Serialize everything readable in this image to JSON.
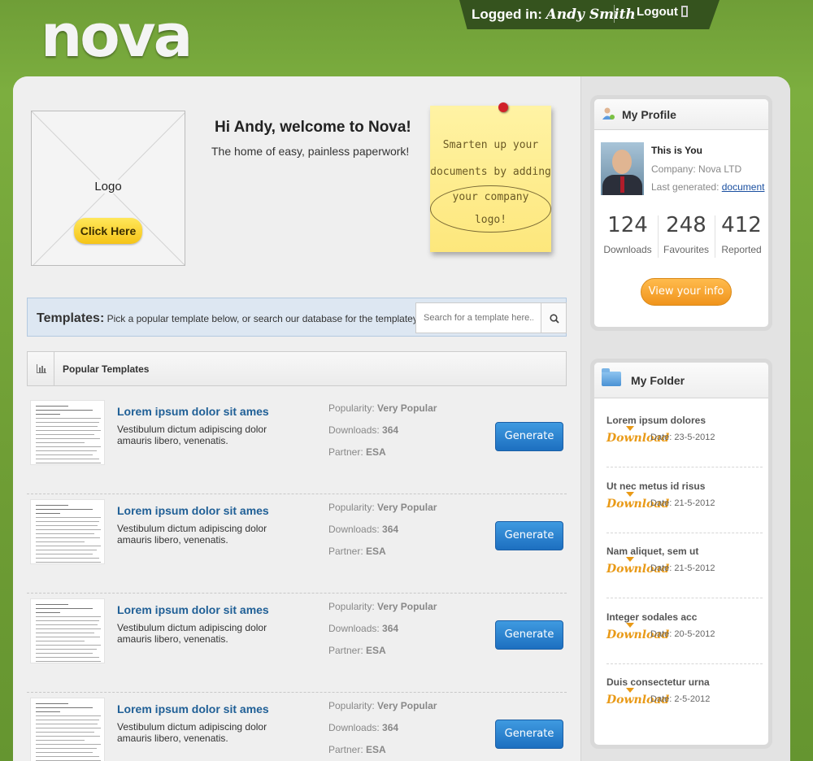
{
  "header": {
    "brand": "nova",
    "logged_in_label": "Logged in:",
    "user_name": "Andy Smith",
    "logout_label": "Logout"
  },
  "welcome": {
    "logo_placeholder": "Logo",
    "click_here": "Click Here",
    "title": "Hi Andy, welcome to Nova!",
    "subtitle": "The home of easy, painless paperwork!",
    "sticky_note": {
      "line1": "Smarten up your",
      "line2": "documents by adding",
      "line3": "your company logo!"
    }
  },
  "templates_bar": {
    "label": "Templates:",
    "text": "Pick a popular template below, or search our database for the templateyou need!",
    "search_placeholder": "Search for a template here..."
  },
  "popular": {
    "title": "Popular Templates",
    "items": [
      {
        "title": "Lorem ipsum dolor sit ames",
        "desc": "Vestibulum dictum adipiscing dolor amauris libero, venenatis.",
        "popularity_label": "Popularity:",
        "popularity": "Very Popular",
        "downloads_label": "Downloads:",
        "downloads": "364",
        "partner_label": "Partner:",
        "partner": "ESA",
        "button": "Generate"
      },
      {
        "title": "Lorem ipsum dolor sit ames",
        "desc": "Vestibulum dictum adipiscing dolor amauris libero, venenatis.",
        "popularity_label": "Popularity:",
        "popularity": "Very Popular",
        "downloads_label": "Downloads:",
        "downloads": "364",
        "partner_label": "Partner:",
        "partner": "ESA",
        "button": "Generate"
      },
      {
        "title": "Lorem ipsum dolor sit ames",
        "desc": "Vestibulum dictum adipiscing dolor amauris libero, venenatis.",
        "popularity_label": "Popularity:",
        "popularity": "Very Popular",
        "downloads_label": "Downloads:",
        "downloads": "364",
        "partner_label": "Partner:",
        "partner": "ESA",
        "button": "Generate"
      },
      {
        "title": "Lorem ipsum dolor sit ames",
        "desc": "Vestibulum dictum adipiscing dolor amauris libero, venenatis.",
        "popularity_label": "Popularity:",
        "popularity": "Very Popular",
        "downloads_label": "Downloads:",
        "downloads": "364",
        "partner_label": "Partner:",
        "partner": "ESA",
        "button": "Generate"
      }
    ]
  },
  "profile": {
    "title": "My Profile",
    "this_is_you": "This is You",
    "company": "Company: Nova LTD",
    "last_generated_label": "Last generated:",
    "last_generated_link": "document",
    "stats": [
      {
        "value": "124",
        "label": "Downloads"
      },
      {
        "value": "248",
        "label": "Favourites"
      },
      {
        "value": "412",
        "label": "Reported"
      }
    ],
    "view_info": "View your info"
  },
  "folder": {
    "title": "My Folder",
    "download_label": "Download",
    "items": [
      {
        "title": "Lorem ipsum dolores",
        "date": "Date: 23-5-2012"
      },
      {
        "title": "Ut nec metus id risus",
        "date": "Date: 21-5-2012"
      },
      {
        "title": "Nam aliquet, sem ut",
        "date": "Date: 21-5-2012"
      },
      {
        "title": "Integer sodales acc",
        "date": "Date: 20-5-2012"
      },
      {
        "title": "Duis consectetur urna",
        "date": "Date: 2-5-2012"
      }
    ]
  },
  "colors": {
    "background_green": "#7cae3f",
    "link_blue": "#1f5f96",
    "generate_blue": "#2a84d4",
    "view_info_orange": "#f5a231",
    "download_orange": "#e99a17"
  }
}
